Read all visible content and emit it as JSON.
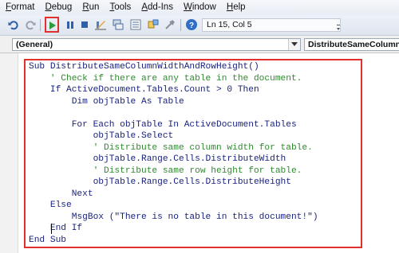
{
  "menu": {
    "items": [
      {
        "label": "Format",
        "accel_index": 0
      },
      {
        "label": "Debug",
        "accel_index": 0
      },
      {
        "label": "Run",
        "accel_index": 0
      },
      {
        "label": "Tools",
        "accel_index": 0
      },
      {
        "label": "Add-Ins",
        "accel_index": 0
      },
      {
        "label": "Window",
        "accel_index": 0
      },
      {
        "label": "Help",
        "accel_index": 0
      }
    ]
  },
  "toolbar": {
    "status_text": "Ln 15, Col 5",
    "run_highlight_color": "#e0312f",
    "icons": [
      "undo-icon",
      "redo-icon",
      "run-sub-icon",
      "break-icon",
      "reset-icon",
      "design-mode-icon",
      "project-explorer-icon",
      "properties-window-icon",
      "object-browser-icon",
      "toolbox-icon",
      "help-icon"
    ]
  },
  "combos": {
    "object": "(General)",
    "procedure": "DistributeSameColumnWidthAndRowHeight"
  },
  "code": {
    "lines": [
      {
        "text": "Sub DistributeSameColumnWidthAndRowHeight()",
        "type": "code"
      },
      {
        "text": "    ' Check if there are any table in the document.",
        "type": "comment"
      },
      {
        "text": "    If ActiveDocument.Tables.Count > 0 Then",
        "type": "code"
      },
      {
        "text": "        Dim objTable As Table",
        "type": "code"
      },
      {
        "text": "",
        "type": "code"
      },
      {
        "text": "        For Each objTable In ActiveDocument.Tables",
        "type": "code"
      },
      {
        "text": "            objTable.Select",
        "type": "code"
      },
      {
        "text": "            ' Distribute same column width for table.",
        "type": "comment"
      },
      {
        "text": "            objTable.Range.Cells.DistributeWidth",
        "type": "code"
      },
      {
        "text": "            ' Distribute same row height for table.",
        "type": "comment"
      },
      {
        "text": "            objTable.Range.Cells.DistributeHeight",
        "type": "code"
      },
      {
        "text": "        Next",
        "type": "code"
      },
      {
        "text": "    Else",
        "type": "code"
      },
      {
        "text": "        MsgBox (\"There is no table in this document!\")",
        "type": "code"
      },
      {
        "text": "    End If",
        "type": "code"
      },
      {
        "text": "End Sub",
        "type": "code"
      }
    ],
    "highlight_color": "#e0312f",
    "comment_color": "#2e8b2e",
    "code_color": "#1a237e"
  }
}
